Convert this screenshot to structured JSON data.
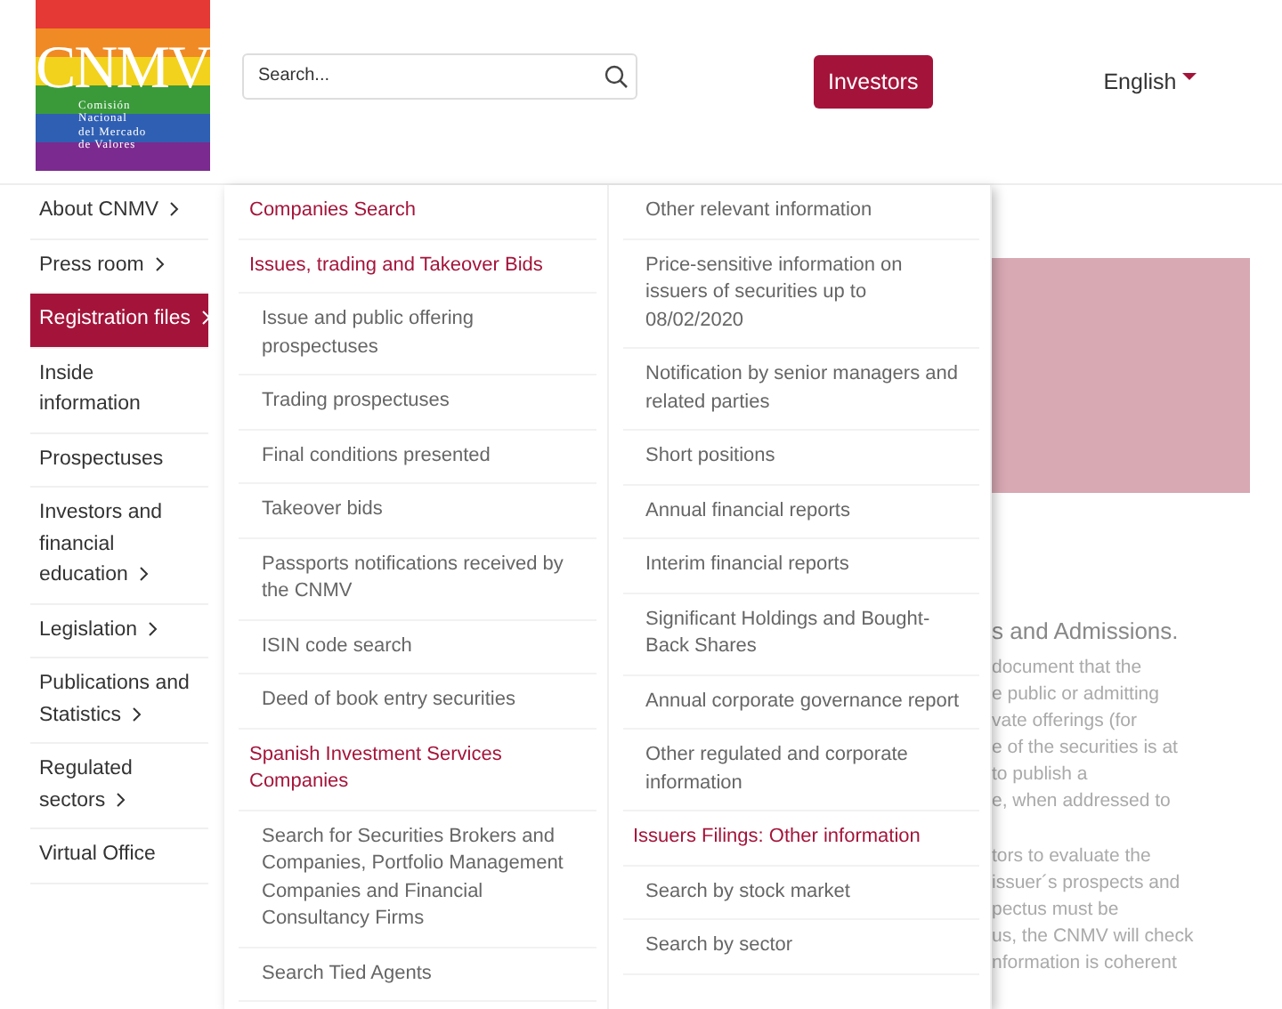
{
  "logo": {
    "wordmark": "CNMV",
    "subtitle": [
      "Comisión",
      "Nacional",
      "del Mercado",
      "de Valores"
    ]
  },
  "search": {
    "placeholder": "Search..."
  },
  "investors_button": "Investors",
  "language": "English",
  "sidebar": {
    "items": [
      {
        "label": "About CNMV",
        "arrow": true,
        "selected": false
      },
      {
        "label": "Press room",
        "arrow": true,
        "selected": false
      },
      {
        "label": "Registration files",
        "arrow": true,
        "selected": true
      },
      {
        "label": "Inside information",
        "arrow": false,
        "selected": false
      },
      {
        "label": "Prospectuses",
        "arrow": false,
        "selected": false
      },
      {
        "label": "Investors and financial education",
        "arrow": true,
        "selected": false
      },
      {
        "label": "Legislation",
        "arrow": true,
        "selected": false
      },
      {
        "label": "Publications and Statistics",
        "arrow": true,
        "selected": false
      },
      {
        "label": "Regulated sectors",
        "arrow": true,
        "selected": false
      },
      {
        "label": "Virtual Office",
        "arrow": false,
        "selected": false
      }
    ]
  },
  "menu": {
    "columns": [
      [
        {
          "kind": "heading",
          "label": "Companies Search"
        },
        {
          "kind": "heading",
          "label": "Issues, trading and Takeover Bids"
        },
        {
          "kind": "item",
          "label": "Issue and public offering prospectuses"
        },
        {
          "kind": "item",
          "label": "Trading prospectuses"
        },
        {
          "kind": "item",
          "label": "Final conditions presented"
        },
        {
          "kind": "item",
          "label": "Takeover bids"
        },
        {
          "kind": "item",
          "label": "Passports notifications received by the CNMV"
        },
        {
          "kind": "item",
          "label": "ISIN code search"
        },
        {
          "kind": "item",
          "label": "Deed of book entry securities"
        },
        {
          "kind": "heading",
          "label": "Spanish Investment Services Companies"
        },
        {
          "kind": "item",
          "label": "Search for Securities Brokers and Companies, Portfolio Management Companies and Financial Consultancy Firms"
        },
        {
          "kind": "item",
          "label": "Search Tied Agents"
        }
      ],
      [
        {
          "kind": "item",
          "label": "Other relevant information"
        },
        {
          "kind": "item",
          "label": "Price-sensitive information on issuers of securities up to 08/02/2020"
        },
        {
          "kind": "item",
          "label": "Notification by senior managers and related parties"
        },
        {
          "kind": "item",
          "label": "Short positions"
        },
        {
          "kind": "item",
          "label": "Annual financial reports"
        },
        {
          "kind": "item",
          "label": "Interim financial reports"
        },
        {
          "kind": "item",
          "label": "Significant Holdings and Bought-Back Shares"
        },
        {
          "kind": "item",
          "label": "Annual corporate governance report"
        },
        {
          "kind": "item",
          "label": "Other regulated and corporate information"
        },
        {
          "kind": "heading",
          "label": "Issuers Filings: Other information"
        },
        {
          "kind": "item",
          "label": "Search by stock market"
        },
        {
          "kind": "item",
          "label": "Search by sector"
        }
      ]
    ]
  },
  "content": {
    "heading": "s and Admissions.",
    "paragraphs": [
      [
        "document that the",
        "e public or admitting",
        "vate offerings (for",
        "e of the securities is at",
        "to publish a",
        "e, when addressed to"
      ],
      [
        "tors to evaluate the",
        "issuer´s prospects and",
        "pectus must be",
        "us, the CNMV will check",
        "nformation is coherent"
      ]
    ]
  }
}
